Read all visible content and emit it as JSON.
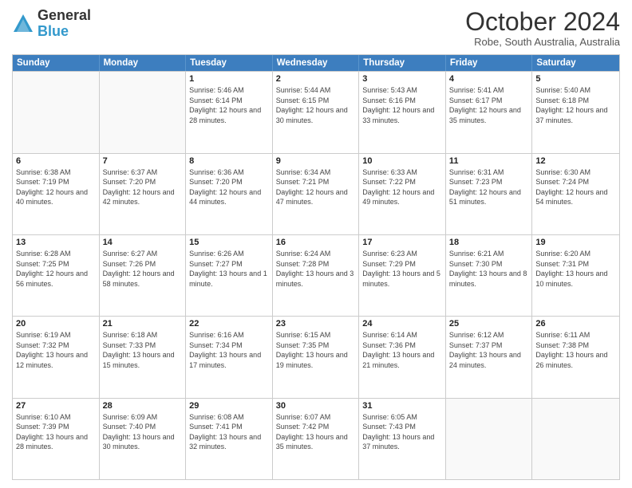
{
  "header": {
    "logo": {
      "general": "General",
      "blue": "Blue"
    },
    "title": "October 2024",
    "subtitle": "Robe, South Australia, Australia"
  },
  "calendar": {
    "days_of_week": [
      "Sunday",
      "Monday",
      "Tuesday",
      "Wednesday",
      "Thursday",
      "Friday",
      "Saturday"
    ],
    "weeks": [
      [
        {
          "day": "",
          "info": "",
          "empty": true
        },
        {
          "day": "",
          "info": "",
          "empty": true
        },
        {
          "day": "1",
          "info": "Sunrise: 5:46 AM\nSunset: 6:14 PM\nDaylight: 12 hours and 28 minutes."
        },
        {
          "day": "2",
          "info": "Sunrise: 5:44 AM\nSunset: 6:15 PM\nDaylight: 12 hours and 30 minutes."
        },
        {
          "day": "3",
          "info": "Sunrise: 5:43 AM\nSunset: 6:16 PM\nDaylight: 12 hours and 33 minutes."
        },
        {
          "day": "4",
          "info": "Sunrise: 5:41 AM\nSunset: 6:17 PM\nDaylight: 12 hours and 35 minutes."
        },
        {
          "day": "5",
          "info": "Sunrise: 5:40 AM\nSunset: 6:18 PM\nDaylight: 12 hours and 37 minutes."
        }
      ],
      [
        {
          "day": "6",
          "info": "Sunrise: 6:38 AM\nSunset: 7:19 PM\nDaylight: 12 hours and 40 minutes."
        },
        {
          "day": "7",
          "info": "Sunrise: 6:37 AM\nSunset: 7:20 PM\nDaylight: 12 hours and 42 minutes."
        },
        {
          "day": "8",
          "info": "Sunrise: 6:36 AM\nSunset: 7:20 PM\nDaylight: 12 hours and 44 minutes."
        },
        {
          "day": "9",
          "info": "Sunrise: 6:34 AM\nSunset: 7:21 PM\nDaylight: 12 hours and 47 minutes."
        },
        {
          "day": "10",
          "info": "Sunrise: 6:33 AM\nSunset: 7:22 PM\nDaylight: 12 hours and 49 minutes."
        },
        {
          "day": "11",
          "info": "Sunrise: 6:31 AM\nSunset: 7:23 PM\nDaylight: 12 hours and 51 minutes."
        },
        {
          "day": "12",
          "info": "Sunrise: 6:30 AM\nSunset: 7:24 PM\nDaylight: 12 hours and 54 minutes."
        }
      ],
      [
        {
          "day": "13",
          "info": "Sunrise: 6:28 AM\nSunset: 7:25 PM\nDaylight: 12 hours and 56 minutes."
        },
        {
          "day": "14",
          "info": "Sunrise: 6:27 AM\nSunset: 7:26 PM\nDaylight: 12 hours and 58 minutes."
        },
        {
          "day": "15",
          "info": "Sunrise: 6:26 AM\nSunset: 7:27 PM\nDaylight: 13 hours and 1 minute."
        },
        {
          "day": "16",
          "info": "Sunrise: 6:24 AM\nSunset: 7:28 PM\nDaylight: 13 hours and 3 minutes."
        },
        {
          "day": "17",
          "info": "Sunrise: 6:23 AM\nSunset: 7:29 PM\nDaylight: 13 hours and 5 minutes."
        },
        {
          "day": "18",
          "info": "Sunrise: 6:21 AM\nSunset: 7:30 PM\nDaylight: 13 hours and 8 minutes."
        },
        {
          "day": "19",
          "info": "Sunrise: 6:20 AM\nSunset: 7:31 PM\nDaylight: 13 hours and 10 minutes."
        }
      ],
      [
        {
          "day": "20",
          "info": "Sunrise: 6:19 AM\nSunset: 7:32 PM\nDaylight: 13 hours and 12 minutes."
        },
        {
          "day": "21",
          "info": "Sunrise: 6:18 AM\nSunset: 7:33 PM\nDaylight: 13 hours and 15 minutes."
        },
        {
          "day": "22",
          "info": "Sunrise: 6:16 AM\nSunset: 7:34 PM\nDaylight: 13 hours and 17 minutes."
        },
        {
          "day": "23",
          "info": "Sunrise: 6:15 AM\nSunset: 7:35 PM\nDaylight: 13 hours and 19 minutes."
        },
        {
          "day": "24",
          "info": "Sunrise: 6:14 AM\nSunset: 7:36 PM\nDaylight: 13 hours and 21 minutes."
        },
        {
          "day": "25",
          "info": "Sunrise: 6:12 AM\nSunset: 7:37 PM\nDaylight: 13 hours and 24 minutes."
        },
        {
          "day": "26",
          "info": "Sunrise: 6:11 AM\nSunset: 7:38 PM\nDaylight: 13 hours and 26 minutes."
        }
      ],
      [
        {
          "day": "27",
          "info": "Sunrise: 6:10 AM\nSunset: 7:39 PM\nDaylight: 13 hours and 28 minutes."
        },
        {
          "day": "28",
          "info": "Sunrise: 6:09 AM\nSunset: 7:40 PM\nDaylight: 13 hours and 30 minutes."
        },
        {
          "day": "29",
          "info": "Sunrise: 6:08 AM\nSunset: 7:41 PM\nDaylight: 13 hours and 32 minutes."
        },
        {
          "day": "30",
          "info": "Sunrise: 6:07 AM\nSunset: 7:42 PM\nDaylight: 13 hours and 35 minutes."
        },
        {
          "day": "31",
          "info": "Sunrise: 6:05 AM\nSunset: 7:43 PM\nDaylight: 13 hours and 37 minutes."
        },
        {
          "day": "",
          "info": "",
          "empty": true
        },
        {
          "day": "",
          "info": "",
          "empty": true
        }
      ]
    ]
  }
}
